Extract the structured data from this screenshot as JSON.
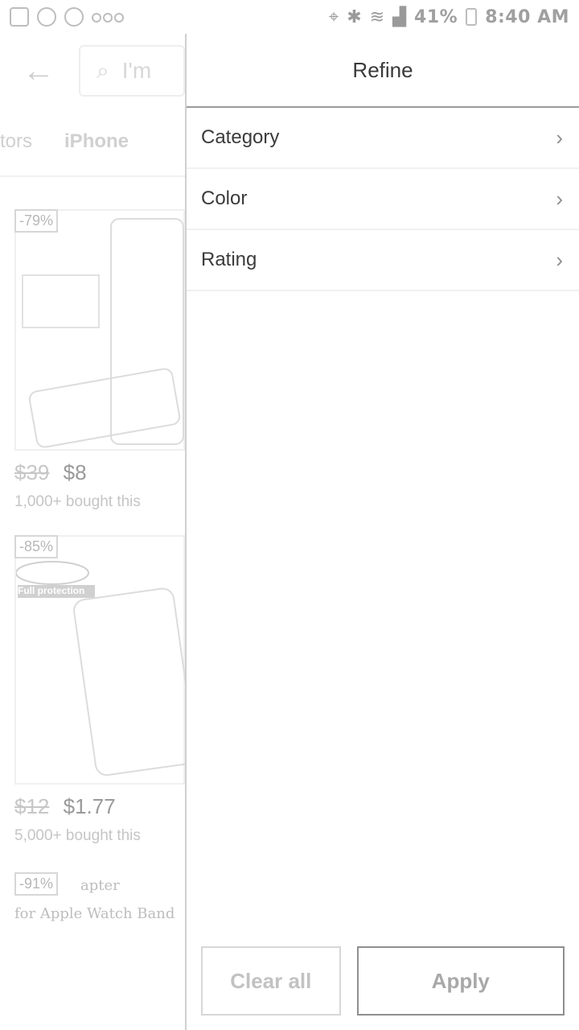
{
  "status_bar": {
    "time": "8:40 AM",
    "battery": "41%",
    "left_icons": [
      "notification-icon",
      "fan-icon",
      "target-icon",
      "more-dots-icon"
    ],
    "right_icons": [
      "location-icon",
      "bluetooth-icon",
      "wifi-icon",
      "signal-icon",
      "battery-icon"
    ]
  },
  "background": {
    "search_text": "I'm",
    "tabs": [
      "tors",
      "iPhone"
    ],
    "products": [
      {
        "discount": "-79%",
        "old_price": "$39",
        "price": "$8",
        "bought": "1,000+ bought this"
      },
      {
        "discount": "-85%",
        "old_price": "$12",
        "price": "$1.77",
        "bought": "5,000+ bought this",
        "overlay": "Full protection"
      },
      {
        "discount": "-91%",
        "caption": "for Apple Watch Band",
        "caption_top": "apter"
      }
    ]
  },
  "drawer": {
    "title": "Refine",
    "items": [
      {
        "label": "Category"
      },
      {
        "label": "Color"
      },
      {
        "label": "Rating"
      }
    ],
    "clear_label": "Clear all",
    "apply_label": "Apply"
  },
  "colors": {
    "divider": "#9b9b9b",
    "text": "#3b3b3b"
  }
}
